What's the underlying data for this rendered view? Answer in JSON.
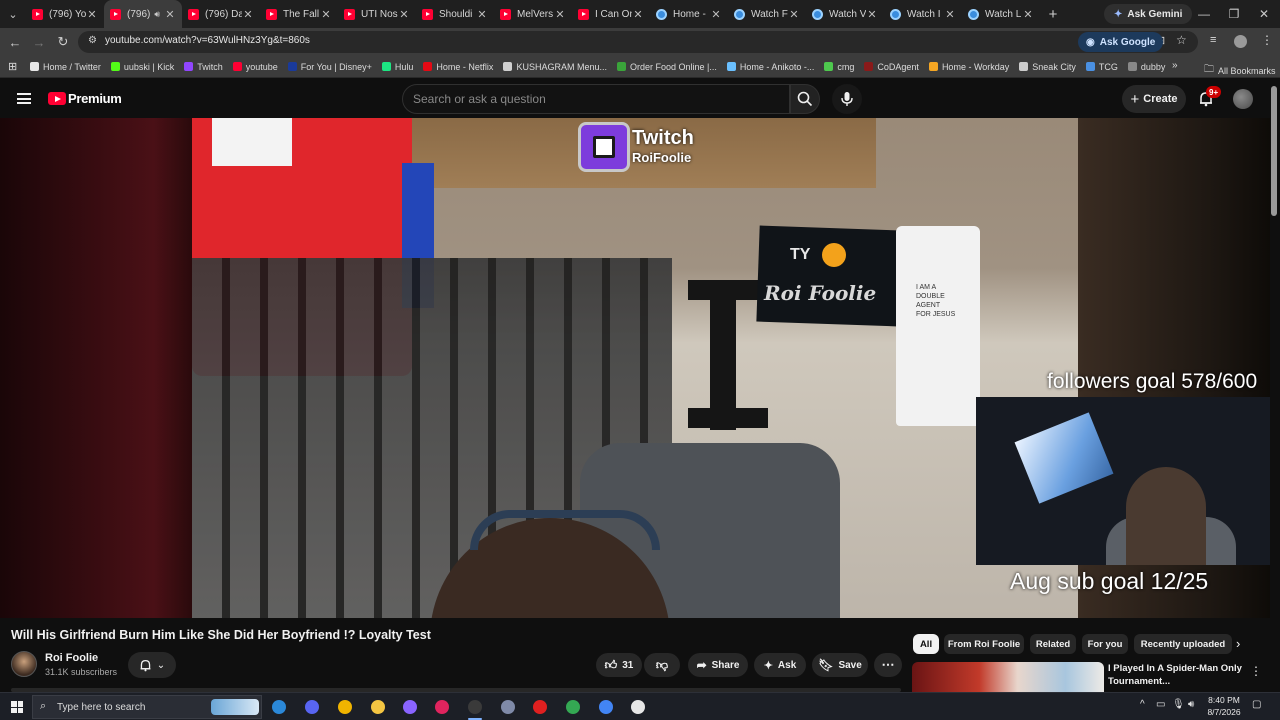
{
  "browser": {
    "tabs": [
      {
        "label": "(796) You",
        "icon": "youtube-icon",
        "active": false
      },
      {
        "label": "(796)",
        "icon": "youtube-icon",
        "active": true,
        "audio": true
      },
      {
        "label": "(796) Da",
        "icon": "youtube-icon",
        "active": false
      },
      {
        "label": "The Fall",
        "icon": "youtube-icon",
        "active": false
      },
      {
        "label": "UTI Nos",
        "icon": "youtube-icon",
        "active": false
      },
      {
        "label": "Shouldi",
        "icon": "youtube-icon",
        "active": false
      },
      {
        "label": "MelVers",
        "icon": "youtube-icon",
        "active": false
      },
      {
        "label": "I Can On",
        "icon": "youtube-icon",
        "active": false
      },
      {
        "label": "Home -",
        "icon": "globe-icon",
        "active": false
      },
      {
        "label": "Watch F",
        "icon": "globe-icon",
        "active": false
      },
      {
        "label": "Watch V",
        "icon": "globe-icon",
        "active": false
      },
      {
        "label": "Watch I",
        "icon": "globe-icon",
        "active": false
      },
      {
        "label": "Watch L",
        "icon": "globe-icon",
        "active": false
      }
    ],
    "new_tab": "+",
    "ask_gemini": "Ask Gemini",
    "url": "youtube.com/watch?v=63WulHNz3Yg&t=860s",
    "ask_google": "Ask Google",
    "bookmarks": [
      {
        "label": "Home / Twitter",
        "color": "#e7e7e7"
      },
      {
        "label": "uubski | Kick",
        "color": "#53fc18"
      },
      {
        "label": "Twitch",
        "color": "#9146ff"
      },
      {
        "label": "youtube",
        "color": "#ff0033"
      },
      {
        "label": "For You | Disney+",
        "color": "#1a3a9a"
      },
      {
        "label": "Hulu",
        "color": "#1ce783"
      },
      {
        "label": "Home - Netflix",
        "color": "#e50914"
      },
      {
        "label": "KUSHAGRAM Menu...",
        "color": "#d0d0d0"
      },
      {
        "label": "Order Food Online |...",
        "color": "#3aa43a"
      },
      {
        "label": "Home - Anikoto -...",
        "color": "#6ac0ff"
      },
      {
        "label": "cmg",
        "color": "#4ec94e"
      },
      {
        "label": "CoDAgent",
        "color": "#8a1a1a"
      },
      {
        "label": "Home - Workday",
        "color": "#f5a623"
      },
      {
        "label": "Sneak City",
        "color": "#cccccc"
      },
      {
        "label": "TCG",
        "color": "#4a90e2"
      },
      {
        "label": "dubby",
        "color": "#888888"
      }
    ],
    "all_bookmarks": "All Bookmarks"
  },
  "youtube": {
    "brand": "Premium",
    "search_placeholder": "Search or ask a question",
    "create_label": "Create",
    "notifications_badge": "9+",
    "video": {
      "overlay_twitch_label": "Twitch",
      "overlay_twitch_user": "RoiFoolie",
      "followers_goal": "followers goal 578/600",
      "sub_goal": "Aug sub goal 12/25",
      "poster_brand": "TY",
      "poster_name": "Roi Foolie",
      "tshirt_text": "I AM A DOUBLE AGENT FOR JESUS"
    },
    "title": "Will His Girlfriend Burn Him Like She Did Her Boyfriend !? Loyalty Test",
    "channel": {
      "name": "Roi Foolie",
      "subscribers": "31.1K subscribers"
    },
    "actions": {
      "likes": "31",
      "share": "Share",
      "ask": "Ask",
      "save": "Save"
    },
    "chips": [
      "All",
      "From Roi Foolie",
      "Related",
      "For you",
      "Recently uploaded"
    ],
    "recommendation": {
      "title": "I Played In A Spider-Man Only Tournament..."
    }
  },
  "taskbar": {
    "search_placeholder": "Type here to search",
    "time": "8:40 PM",
    "date": "8/7/2026"
  }
}
